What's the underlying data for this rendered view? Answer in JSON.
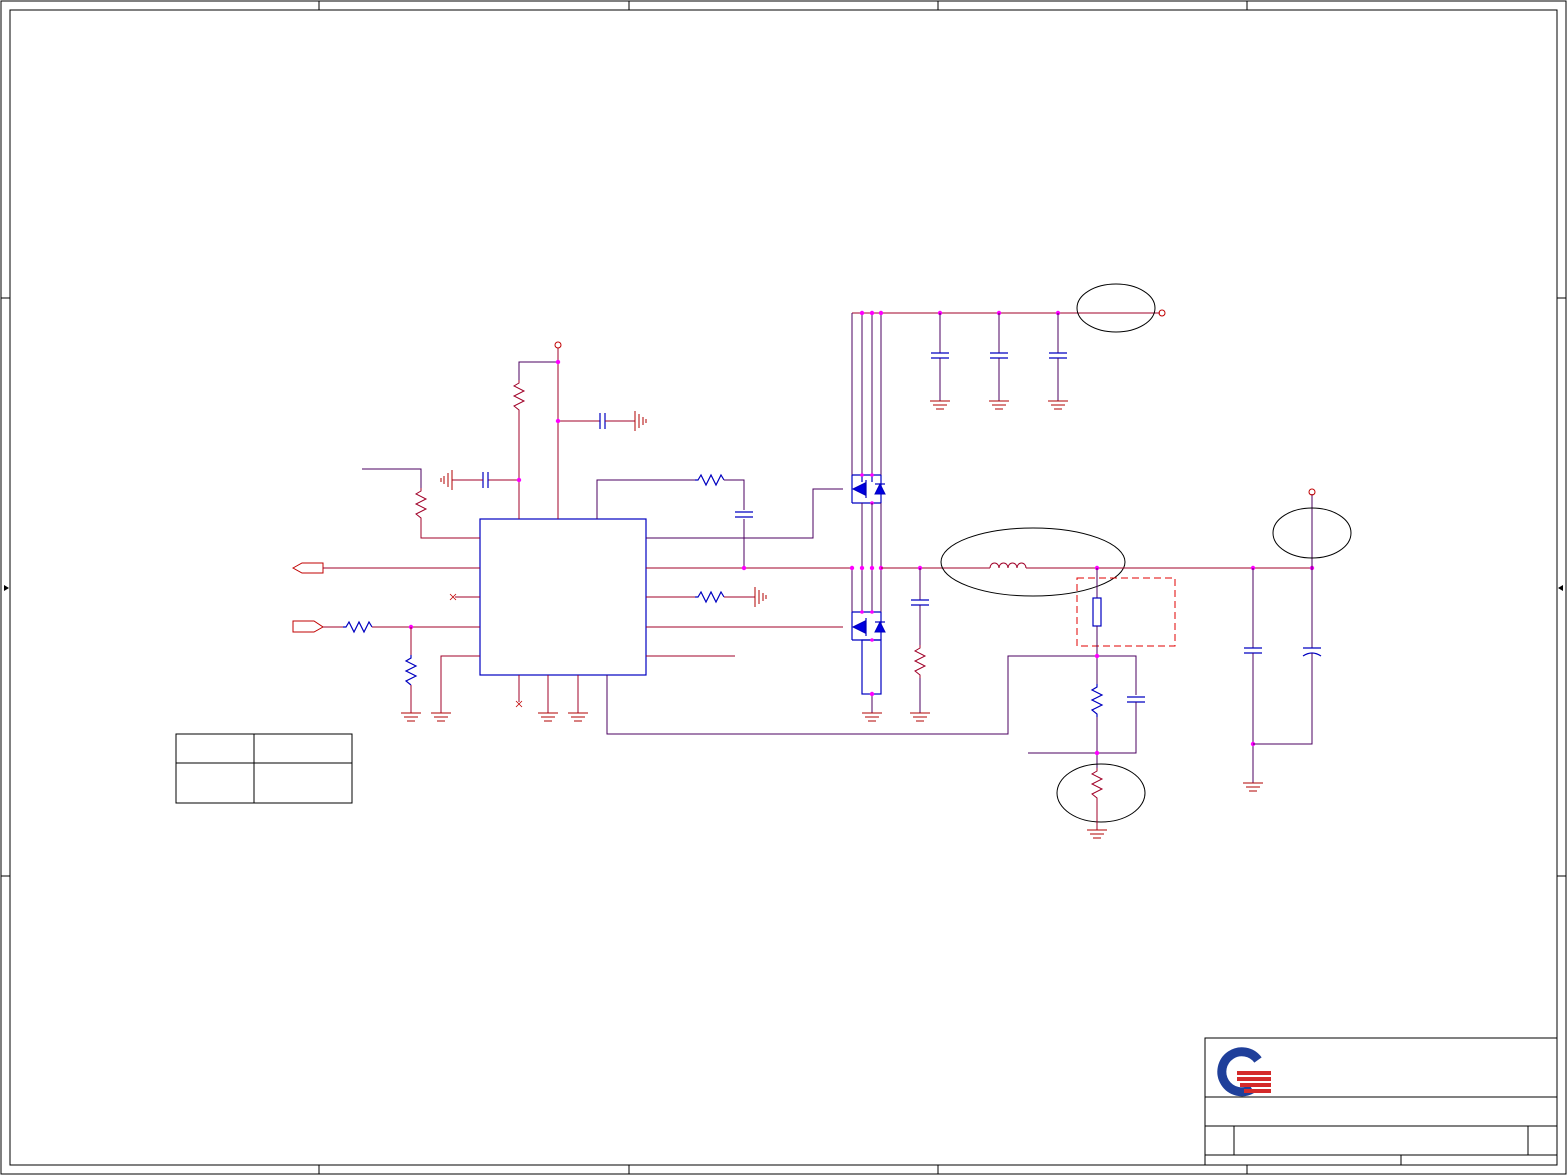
{
  "schematic": {
    "logo": {
      "name": "company-logo",
      "colors": {
        "ring": "#1f3f9a",
        "bars": "#d42a2a"
      }
    },
    "colors": {
      "wire": "#a00028",
      "net": "#4b0060",
      "component": "#0000c0",
      "junction": "#ff00ff",
      "border": "#000000"
    }
  }
}
